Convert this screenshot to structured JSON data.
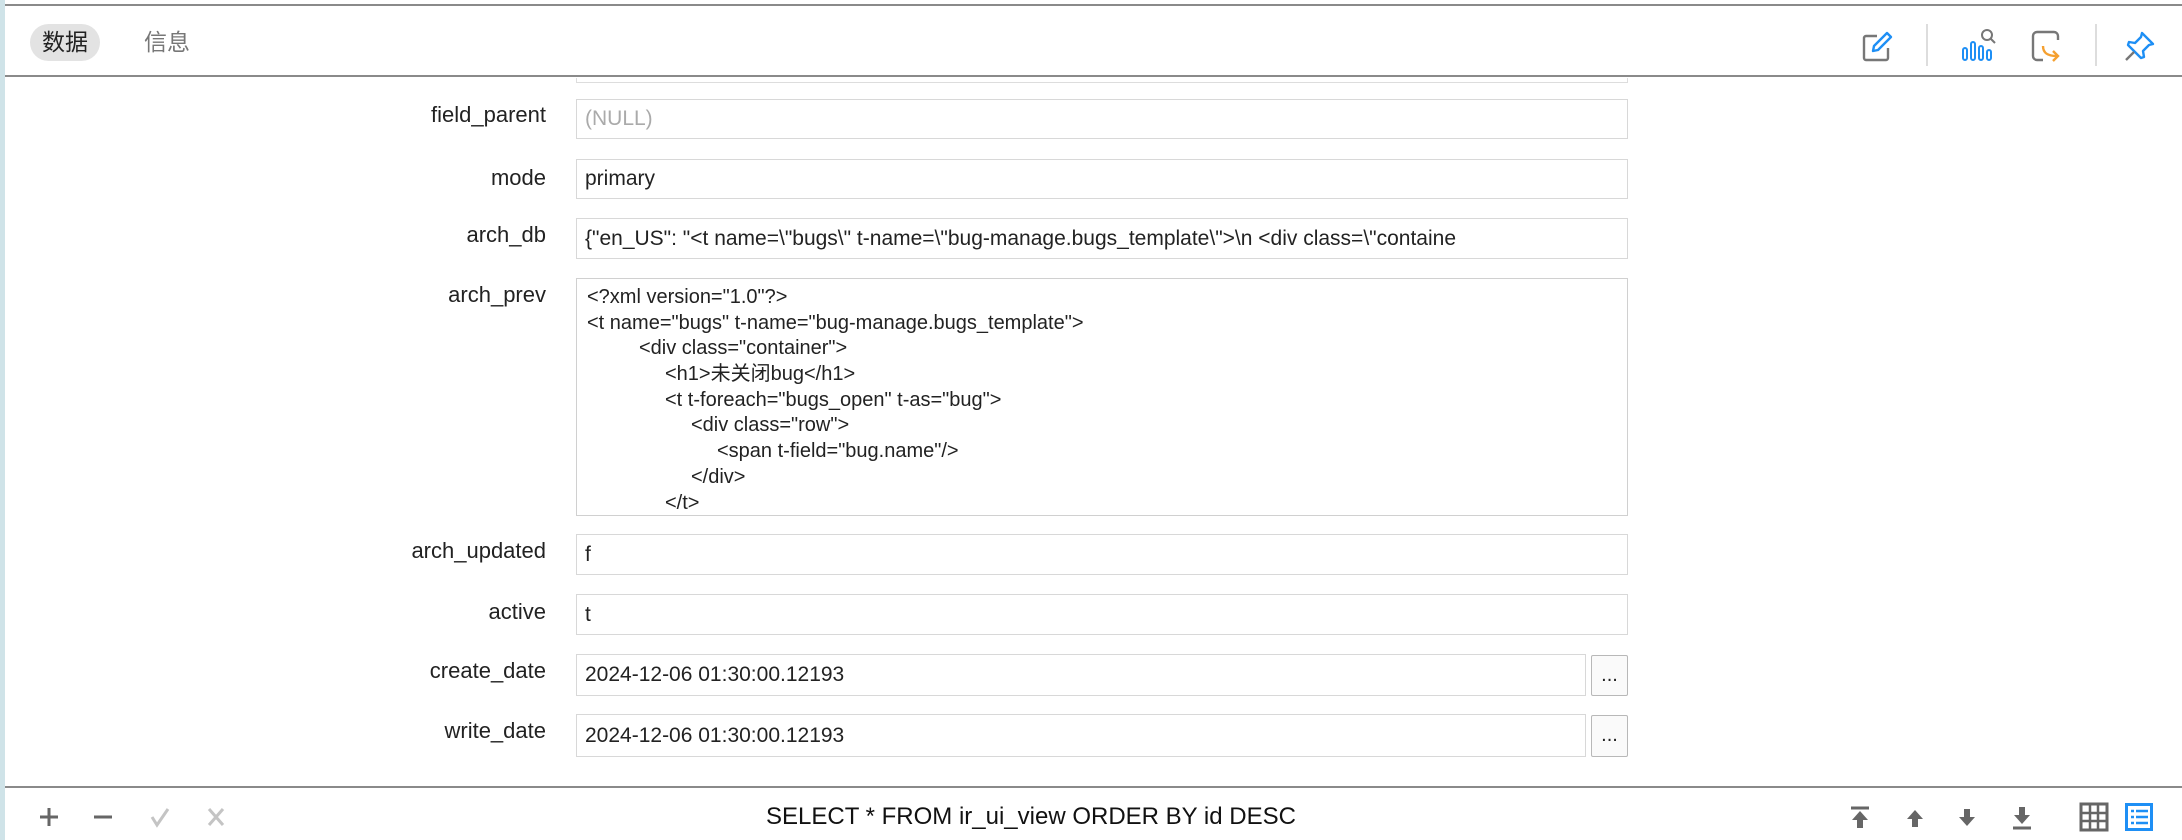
{
  "tabs": [
    {
      "label": "数据",
      "active": true
    },
    {
      "label": "信息",
      "active": false
    }
  ],
  "toolbar_icons": [
    "edit-icon",
    "chart-search-icon",
    "export-icon",
    "pin-icon"
  ],
  "fields": {
    "field_parent": {
      "label": "field_parent",
      "value": "(NULL)"
    },
    "mode": {
      "label": "mode",
      "value": "primary"
    },
    "arch_db": {
      "label": "arch_db",
      "value": "{\"en_US\": \"<t name=\\\"bugs\\\" t-name=\\\"bug-manage.bugs_template\\\">\\n        <div class=\\\"containe"
    },
    "arch_prev": {
      "label": "arch_prev",
      "lines": [
        "<?xml version=\"1.0\"?>",
        "<t name=\"bugs\" t-name=\"bug-manage.bugs_template\">",
        "<div class=\"container\">",
        "<h1>未关闭bug</h1>",
        "<t t-foreach=\"bugs_open\" t-as=\"bug\">",
        "<div class=\"row\">",
        "<span t-field=\"bug.name\"/>",
        "</div>",
        "</t>"
      ]
    },
    "arch_updated": {
      "label": "arch_updated",
      "value": "f"
    },
    "active": {
      "label": "active",
      "value": "t"
    },
    "create_date": {
      "label": "create_date",
      "value": "2024-12-06 01:30:00.12193",
      "button": "..."
    },
    "write_date": {
      "label": "write_date",
      "value": "2024-12-06 01:30:00.12193",
      "button": "..."
    }
  },
  "bottom": {
    "sql": "SELECT * FROM ir_ui_view ORDER BY id DESC",
    "left_icons": [
      "add-icon",
      "remove-icon",
      "apply-icon",
      "discard-icon"
    ],
    "right_icons": [
      "first-record-icon",
      "previous-record-icon",
      "next-record-icon",
      "last-record-icon",
      "grid-view-icon",
      "form-view-icon"
    ]
  },
  "colors": {
    "accent": "#1e8ff5",
    "orange": "#f5a030",
    "icon_gray": "#777777"
  }
}
